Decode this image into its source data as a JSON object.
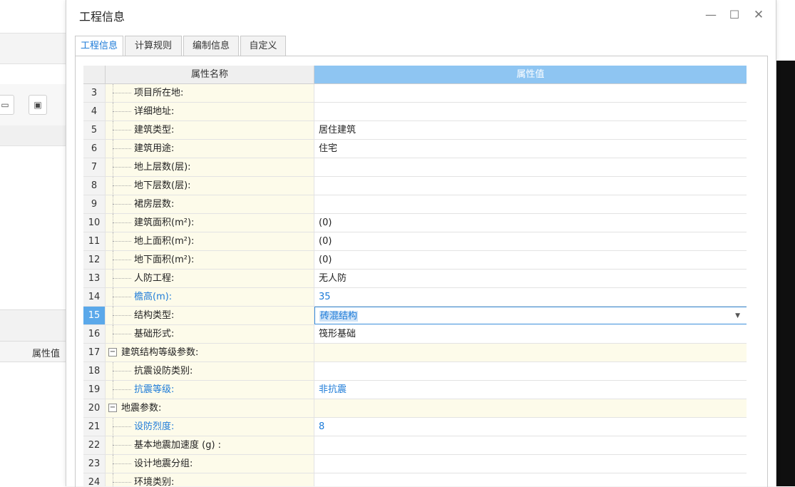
{
  "dialog": {
    "title": "工程信息",
    "window_buttons": {
      "minimize": "—",
      "maximize": "☐",
      "close": "✕"
    },
    "tabs": [
      {
        "label": "工程信息",
        "active": true
      },
      {
        "label": "计算规则",
        "active": false
      },
      {
        "label": "编制信息",
        "active": false
      },
      {
        "label": "自定义",
        "active": false
      }
    ]
  },
  "grid": {
    "headers": {
      "name": "属性名称",
      "value": "属性值"
    },
    "rows": [
      {
        "num": "3",
        "name": "项目所在地:",
        "value": "",
        "style": "normal"
      },
      {
        "num": "4",
        "name": "详细地址:",
        "value": "",
        "style": "normal"
      },
      {
        "num": "5",
        "name": "建筑类型:",
        "value": "居住建筑",
        "style": "normal"
      },
      {
        "num": "6",
        "name": "建筑用途:",
        "value": "住宅",
        "style": "normal"
      },
      {
        "num": "7",
        "name": "地上层数(层):",
        "value": "",
        "style": "normal"
      },
      {
        "num": "8",
        "name": "地下层数(层):",
        "value": "",
        "style": "normal"
      },
      {
        "num": "9",
        "name": "裙房层数:",
        "value": "",
        "style": "normal"
      },
      {
        "num": "10",
        "name": "建筑面积(m²):",
        "value": "(0)",
        "style": "normal"
      },
      {
        "num": "11",
        "name": "地上面积(m²):",
        "value": "(0)",
        "style": "normal"
      },
      {
        "num": "12",
        "name": "地下面积(m²):",
        "value": "(0)",
        "style": "normal"
      },
      {
        "num": "13",
        "name": "人防工程:",
        "value": "无人防",
        "style": "normal"
      },
      {
        "num": "14",
        "name": "檐高(m):",
        "value": "35",
        "style": "blue"
      },
      {
        "num": "15",
        "name": "结构类型:",
        "value": "砖混结构",
        "style": "selected"
      },
      {
        "num": "16",
        "name": "基础形式:",
        "value": "筏形基础",
        "style": "normal"
      },
      {
        "num": "17",
        "name": "建筑结构等级参数:",
        "value": "",
        "style": "group",
        "toggle": "−"
      },
      {
        "num": "18",
        "name": "抗震设防类别:",
        "value": "",
        "style": "normal"
      },
      {
        "num": "19",
        "name": "抗震等级:",
        "value": "非抗震",
        "style": "blue"
      },
      {
        "num": "20",
        "name": "地震参数:",
        "value": "",
        "style": "group",
        "toggle": "−"
      },
      {
        "num": "21",
        "name": "设防烈度:",
        "value": "8",
        "style": "blue"
      },
      {
        "num": "22",
        "name": "基本地震加速度 (g) :",
        "value": "",
        "style": "normal"
      },
      {
        "num": "23",
        "name": "设计地震分组:",
        "value": "",
        "style": "normal"
      },
      {
        "num": "24",
        "name": "环境类别:",
        "value": "",
        "style": "normal"
      }
    ]
  },
  "background": {
    "left_panel_column_header": "属性值"
  },
  "colors": {
    "accent": "#1d7bd8",
    "header_value_bg": "#8ec5f2",
    "name_cell_bg": "#fdfbea",
    "selected_num_bg": "#5aa8ea"
  }
}
